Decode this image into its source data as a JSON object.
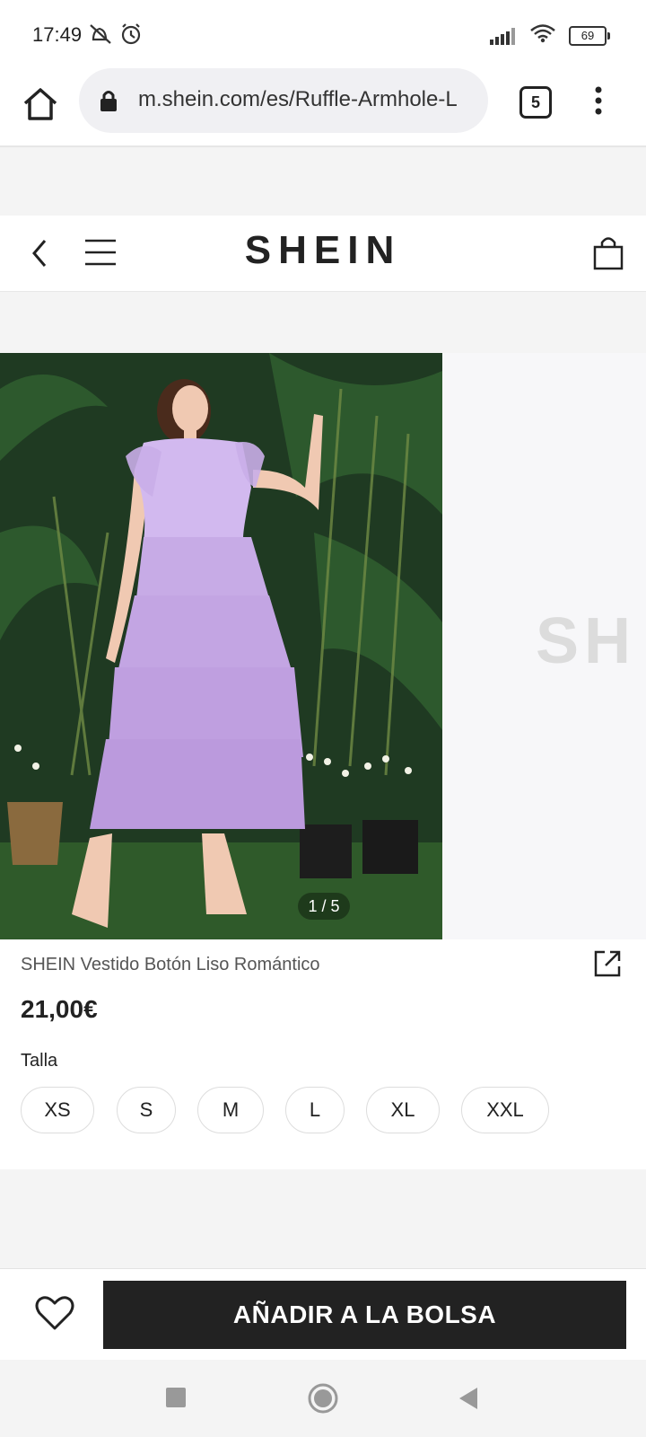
{
  "status_bar": {
    "time": "17:49",
    "battery": "69"
  },
  "browser": {
    "url": "m.shein.com/es/Ruffle-Armhole-L",
    "tab_count": "5"
  },
  "header": {
    "logo": "SHEIN"
  },
  "gallery": {
    "counter": "1 / 5",
    "next_image_logo": "SH"
  },
  "product": {
    "title": "SHEIN Vestido Botón Liso Romántico",
    "price": "21,00€",
    "size_label": "Talla",
    "sizes": [
      "XS",
      "S",
      "M",
      "L",
      "XL",
      "XXL"
    ]
  },
  "actions": {
    "add_to_bag": "AÑADIR A LA BOLSA"
  },
  "colors": {
    "dress": "#c9aee8",
    "background_foliage": "#1f3a22",
    "grass": "#2f5a2a"
  }
}
